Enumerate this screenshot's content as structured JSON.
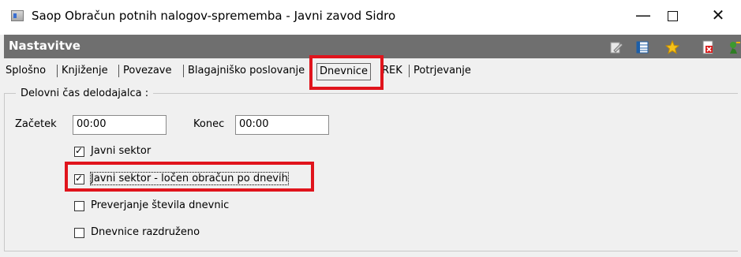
{
  "window": {
    "title": "Saop Obračun potnih nalogov-sprememba - Javni zavod Sidro",
    "minimize_glyph": "—",
    "close_glyph": "✕"
  },
  "header": {
    "title": "Nastavitve",
    "icons": [
      "edit-icon",
      "table-icon",
      "star-icon",
      "delete-icon",
      "exit-icon"
    ]
  },
  "tabs": [
    {
      "label": "Splošno",
      "active": false
    },
    {
      "label": "Knjiženje",
      "active": false
    },
    {
      "label": "Povezave",
      "active": false
    },
    {
      "label": "Blagajniško poslovanje",
      "active": false
    },
    {
      "label": "Dnevnice",
      "active": true
    },
    {
      "label": "REK",
      "active": false
    },
    {
      "label": "Potrjevanje",
      "active": false
    }
  ],
  "group": {
    "label": "Delovni čas delodajalca :",
    "start_label": "Začetek",
    "start_value": "00:00",
    "end_label": "Konec",
    "end_value": "00:00"
  },
  "checkboxes": [
    {
      "label": "Javni sektor",
      "checked": true
    },
    {
      "label": "Javni sektor - ločen obračun po dnevih",
      "checked": true
    },
    {
      "label": "Preverjanje števila dnevnic",
      "checked": false
    },
    {
      "label": "Dnevnice razdruženo",
      "checked": false
    }
  ],
  "colors": {
    "header_bg": "#6f6f6f",
    "highlight": "#e0141c"
  }
}
